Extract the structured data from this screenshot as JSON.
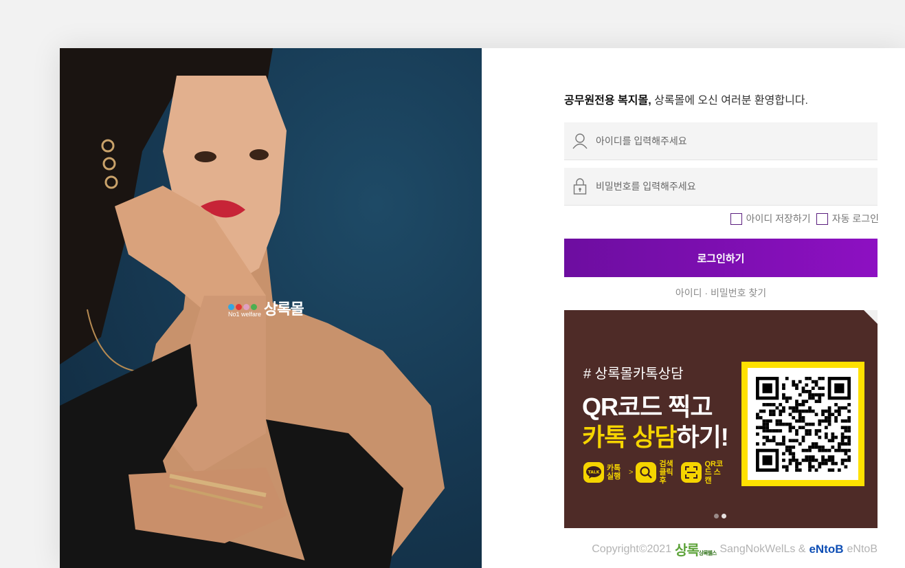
{
  "hero": {
    "logo_tagline": "No1 welfare",
    "logo_name": "상록몰"
  },
  "login": {
    "welcome_bold": "공무원전용 복지몰,",
    "welcome_rest": " 상록몰에 오신 여러분 환영합니다.",
    "id_placeholder": "아이디를 입력해주세요",
    "pw_placeholder": "비밀번호를 입력해주세요",
    "save_id_label": "아이디 저장하기",
    "auto_login_label": "자동 로그인",
    "login_button": "로그인하기",
    "find_link": "아이디 · 비밀번호 찾기"
  },
  "banner": {
    "hashtag": "# 상록몰카톡상담",
    "line1": "QR코드 찍고",
    "line2_yellow": "카톡 상담",
    "line2_white": "하기!",
    "steps": [
      {
        "icon": "talk-icon",
        "icon_text": "TALK",
        "label": "카톡 실행"
      },
      {
        "icon": "search-icon",
        "label": "검색 클릭 후"
      },
      {
        "icon": "qr-scan-icon",
        "label": "QR코드 스캔"
      }
    ],
    "step_arrow": ">",
    "slide_count": 2,
    "active_slide": 2
  },
  "footer": {
    "copyright": "Copyright©2021",
    "brand_mark": "상록",
    "brand_mark_small": "상록웰스",
    "brand_name": "SangNokWelLs &",
    "partner_logo": "eNtoB",
    "partner_name": "eNtoB"
  },
  "colors": {
    "accent_purple": "#7a0db0",
    "banner_bg": "#4e2b27",
    "banner_yellow": "#f5d400",
    "page_bg": "#f2f2f2"
  }
}
